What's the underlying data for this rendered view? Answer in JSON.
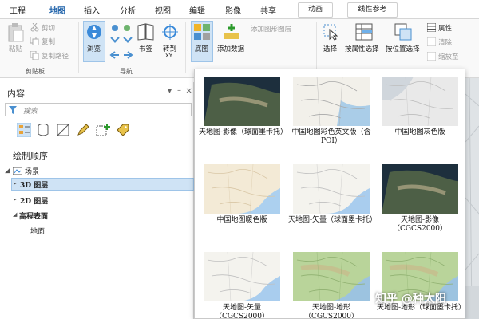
{
  "tabs": [
    "工程",
    "地图",
    "插入",
    "分析",
    "视图",
    "编辑",
    "影像",
    "共享"
  ],
  "context_tabs": [
    "动画",
    "线性参考"
  ],
  "clipboard": {
    "paste": "粘贴",
    "cut": "剪切",
    "copy": "复制",
    "copy_path": "复制路径",
    "group": "剪贴板"
  },
  "navigate": {
    "explore": "浏览",
    "bookmarks": "书签",
    "goto": "转到",
    "goto_sub": "XY",
    "group": "导航"
  },
  "layer": {
    "basemap": "底图",
    "add_data": "添加数据",
    "add_graphics": "添加图形图层"
  },
  "selection": {
    "select": "选择",
    "by_attr": "按属性选择",
    "by_location": "按位置选择",
    "attributes": "属性",
    "clear": "清除",
    "zoom_to": "缩放至"
  },
  "contents": {
    "title": "内容",
    "search_placeholder": "搜索",
    "drawing_order": "绘制顺序",
    "scene": "场景",
    "layer_3d": "3D 图层",
    "layer_2d": "2D 图层",
    "elevation": "高程表面",
    "ground": "地面",
    "pin": "–",
    "close": "×"
  },
  "basemaps": [
    {
      "label": "天地图-影像（球面墨卡托）",
      "style": "imagery"
    },
    {
      "label": "中国地图彩色英文版（含POI）",
      "style": "street"
    },
    {
      "label": "中国地图灰色版",
      "style": "gray"
    },
    {
      "label": "中国地图暖色版",
      "style": "warm"
    },
    {
      "label": "天地图-矢量（球面墨卡托）",
      "style": "vector"
    },
    {
      "label": "天地图-影像（CGCS2000）",
      "style": "imagery"
    },
    {
      "label": "天地图-矢量（CGCS2000）",
      "style": "vector"
    },
    {
      "label": "天地图-地形（CGCS2000）",
      "style": "terrain"
    },
    {
      "label": "天地图-地形（球面墨卡托）",
      "style": "terrain"
    }
  ],
  "watermark": "知乎 @种太阳",
  "colors": {
    "accent": "#1a5fa8",
    "selection": "#cfe3f5",
    "imagery": "#2d4a33",
    "water": "#a9cdee",
    "warm": "#f1e8d3",
    "terrain": "#b9d49a"
  }
}
